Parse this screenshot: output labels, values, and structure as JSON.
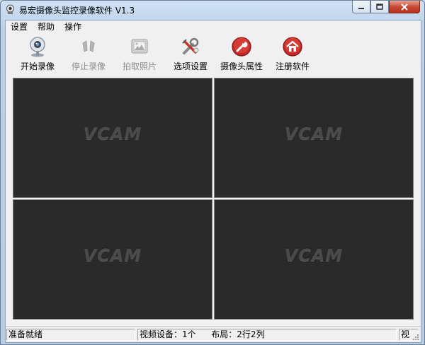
{
  "window": {
    "title": "易宏摄像头监控录像软件 V1.3"
  },
  "menu": [
    "设置",
    "帮助",
    "操作"
  ],
  "toolbar": [
    {
      "label": "开始录像",
      "icon": "webcam-icon",
      "enabled": true
    },
    {
      "label": "停止录像",
      "icon": "stop-record-icon",
      "enabled": false
    },
    {
      "label": "拍取照片",
      "icon": "photo-icon",
      "enabled": false
    },
    {
      "label": "选项设置",
      "icon": "options-tools-icon",
      "enabled": true
    },
    {
      "label": "摄像头属性",
      "icon": "wrench-icon",
      "enabled": true
    },
    {
      "label": "注册软件",
      "icon": "home-icon",
      "enabled": true
    }
  ],
  "panes": [
    {
      "watermark": "VCAM"
    },
    {
      "watermark": "VCAM"
    },
    {
      "watermark": "VCAM"
    },
    {
      "watermark": "VCAM"
    }
  ],
  "status": {
    "ready": "准备就绪",
    "devices": "视频设备：1个",
    "layout": "布局：2行2列",
    "extra": "视"
  }
}
